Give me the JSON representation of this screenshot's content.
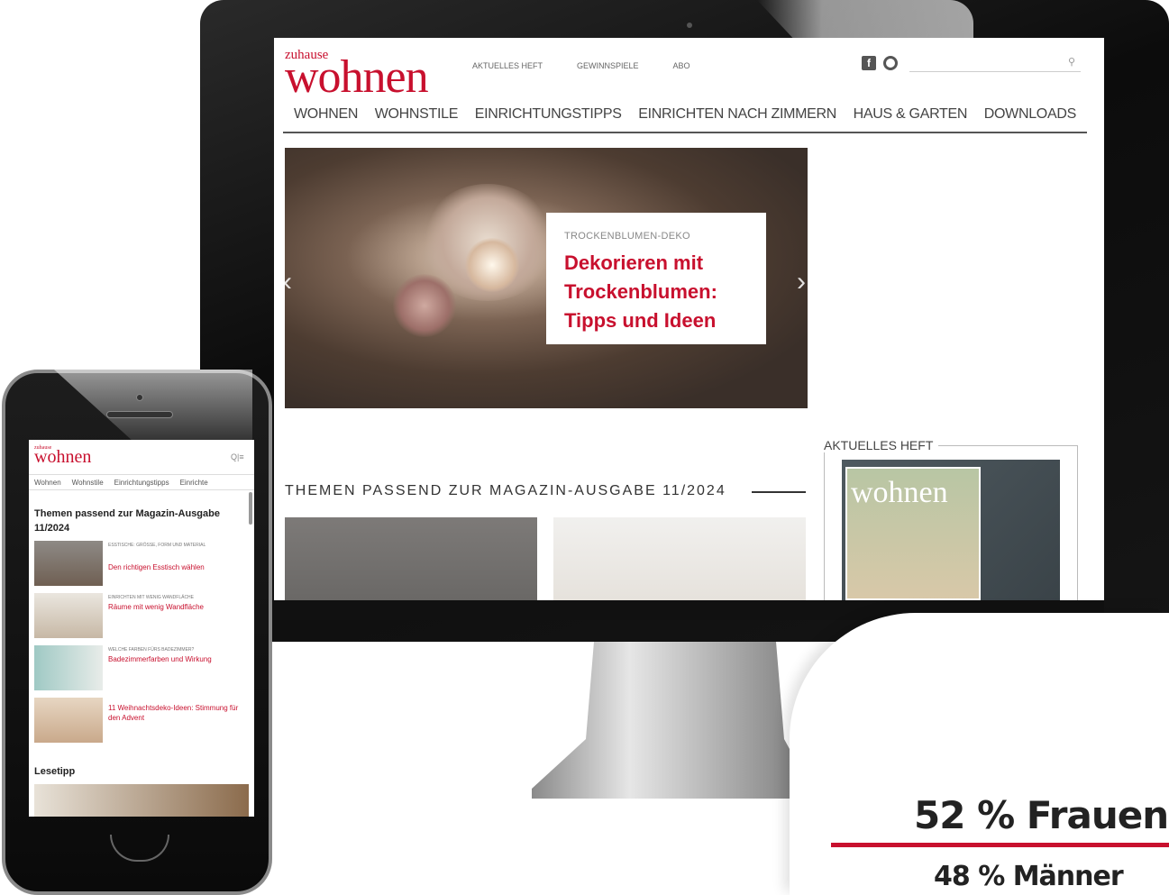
{
  "desktop": {
    "logo_small": "zuhause",
    "logo_big": "wohnen",
    "top_links": [
      "AKTUELLES HEFT",
      "GEWINNSPIELE",
      "ABO"
    ],
    "nav": [
      "WOHNEN",
      "WOHNSTILE",
      "EINRICHTUNGSTIPPS",
      "EINRICHTEN NACH ZIMMERN",
      "HAUS & GARTEN",
      "DOWNLOADS"
    ],
    "hero": {
      "kicker": "TROCKENBLUMEN-DEKO",
      "title_line1": "Dekorieren mit",
      "title_line2": "Trockenblumen:",
      "title_line3": "Tipps und Ideen",
      "prev": "‹",
      "next": "›"
    },
    "section_title": "THEMEN PASSEND ZUR MAGAZIN-AUSGABE 11/2024",
    "heft_label": "AKTUELLES HEFT",
    "heft_cover_title": "wohnen"
  },
  "mobile": {
    "logo_small": "zuhause",
    "logo_big": "wohnen",
    "icons": "Q|≡",
    "nav": [
      "Wohnen",
      "Wohnstile",
      "Einrichtungstipps",
      "Einrichte"
    ],
    "heading": "Themen passend zur Magazin-Ausgabe 11/2024",
    "items": [
      {
        "kicker": "ESSTISCHE: GRÖSSE, FORM UND MATERIAL",
        "title": "Den richtigen Esstisch wählen"
      },
      {
        "kicker": "EINRICHTEN MIT WENIG WANDFLÄCHE",
        "title": "Räume mit wenig Wandfläche"
      },
      {
        "kicker": "WELCHE FARBEN FÜRS BADEZIMMER?",
        "title": "Badezimmerfarben und Wirkung"
      },
      {
        "kicker": "",
        "title": "11 Weihnachtsdeko-Ideen: Stimmung für den Advent"
      }
    ],
    "lesetipp": "Lesetipp"
  },
  "badge": {
    "primary": "52 % Frauen",
    "secondary": "48 % Männer",
    "accent_color": "#c8102e"
  }
}
